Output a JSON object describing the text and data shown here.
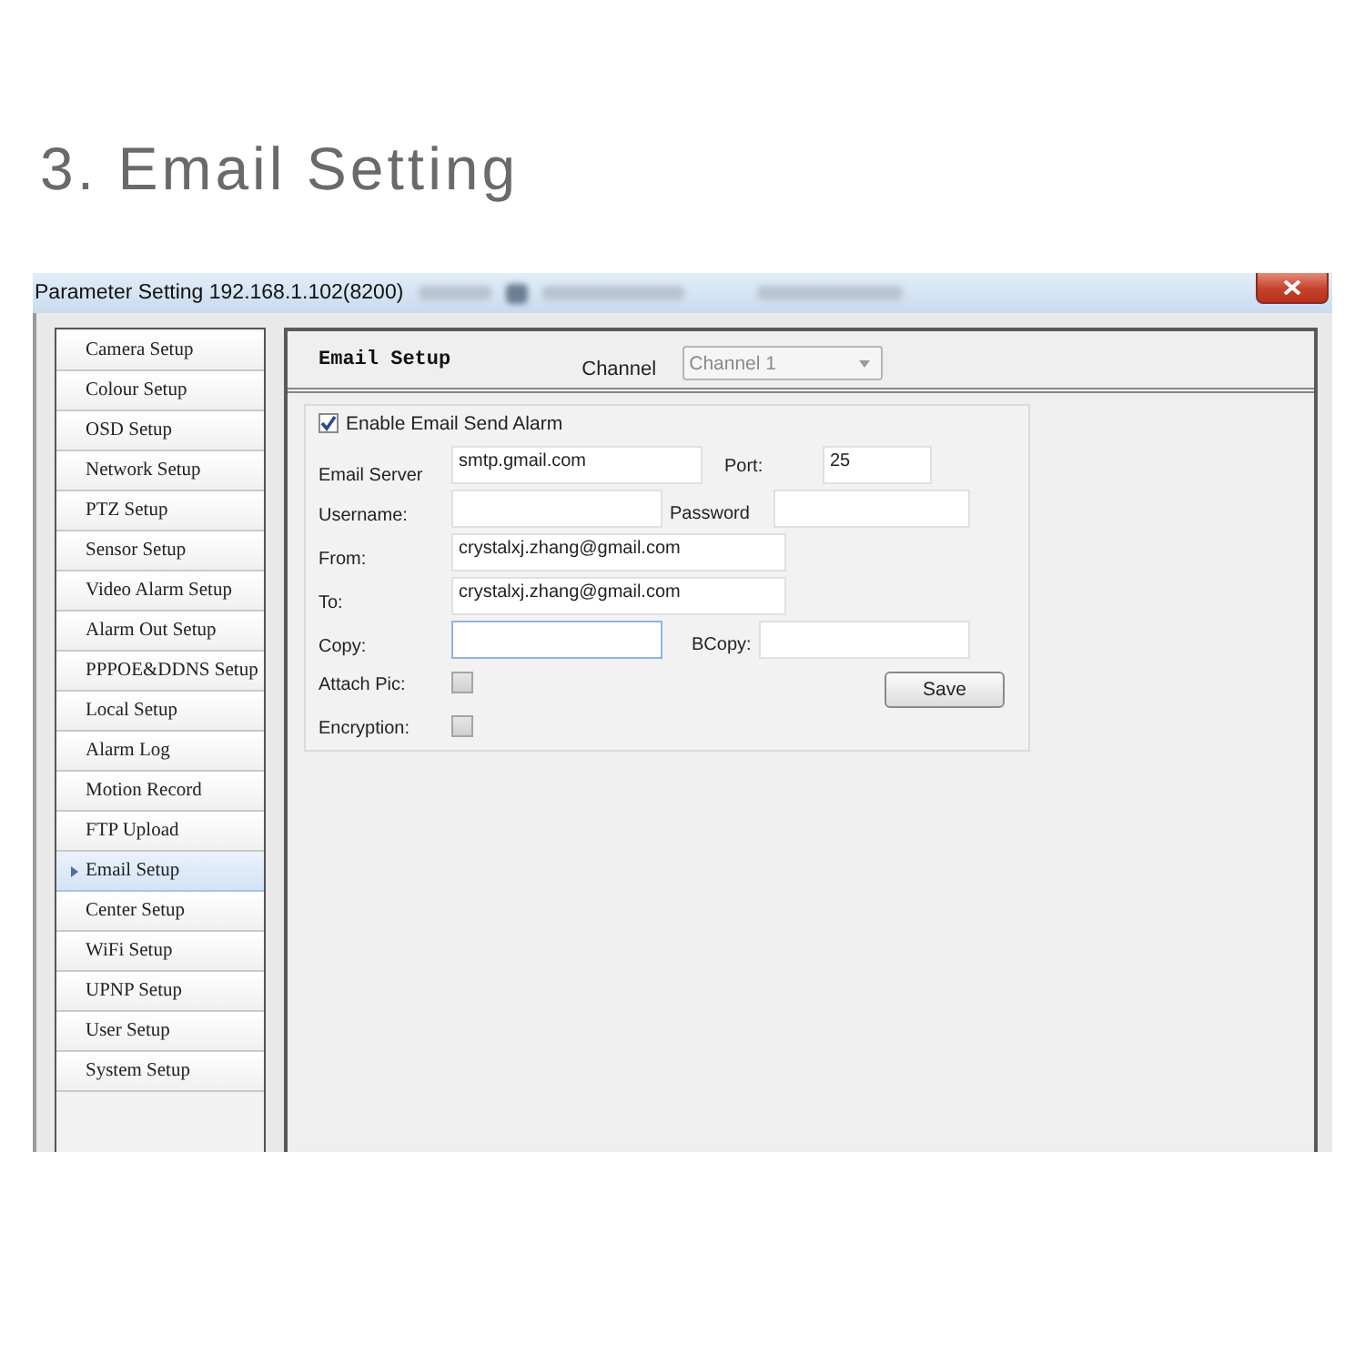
{
  "heading": "3. Email Setting",
  "window": {
    "title": "Parameter Setting 192.168.1.102(8200)"
  },
  "sidebar": {
    "items": [
      {
        "label": "Camera Setup",
        "selected": false
      },
      {
        "label": "Colour Setup",
        "selected": false
      },
      {
        "label": "OSD Setup",
        "selected": false
      },
      {
        "label": "Network Setup",
        "selected": false
      },
      {
        "label": "PTZ Setup",
        "selected": false
      },
      {
        "label": "Sensor Setup",
        "selected": false
      },
      {
        "label": "Video Alarm Setup",
        "selected": false
      },
      {
        "label": "Alarm Out Setup",
        "selected": false
      },
      {
        "label": "PPPOE&DDNS Setup",
        "selected": false
      },
      {
        "label": "Local Setup",
        "selected": false
      },
      {
        "label": "Alarm Log",
        "selected": false
      },
      {
        "label": "Motion Record",
        "selected": false
      },
      {
        "label": "FTP Upload",
        "selected": false
      },
      {
        "label": "Email Setup",
        "selected": true
      },
      {
        "label": "Center Setup",
        "selected": false
      },
      {
        "label": "WiFi Setup",
        "selected": false
      },
      {
        "label": "UPNP Setup",
        "selected": false
      },
      {
        "label": "User Setup",
        "selected": false
      },
      {
        "label": "System Setup",
        "selected": false
      }
    ]
  },
  "panel": {
    "title": "Email Setup",
    "channel": {
      "label": "Channel",
      "value": "Channel 1",
      "disabled": true
    }
  },
  "form": {
    "enable": {
      "label": "Enable Email Send Alarm",
      "checked": true
    },
    "rows": [
      {
        "items": [
          {
            "kind": "input",
            "label": "Email Server",
            "value": "smtp.gmail.com",
            "focused": false
          },
          {
            "kind": "input",
            "label": "Port:",
            "value": "25",
            "focused": false
          }
        ]
      },
      {
        "items": [
          {
            "kind": "input",
            "label": "Username:",
            "focused": false
          },
          {
            "kind": "input",
            "label": "Password",
            "focused": false
          }
        ]
      },
      {
        "items": [
          {
            "kind": "input",
            "label": "From:",
            "value": "crystalxj.zhang@gmail.com",
            "focused": false
          }
        ]
      },
      {
        "items": [
          {
            "kind": "input",
            "label": "To:",
            "value": "crystalxj.zhang@gmail.com",
            "focused": false
          }
        ]
      },
      {
        "items": [
          {
            "kind": "input",
            "label": "Copy:",
            "focused": true
          },
          {
            "kind": "input",
            "label": "BCopy:",
            "focused": false
          }
        ]
      },
      {
        "items": [
          {
            "kind": "checkbox",
            "label": "Attach Pic:",
            "checked": false
          },
          {
            "kind": "button",
            "label": "Save"
          }
        ]
      },
      {
        "items": [
          {
            "kind": "checkbox",
            "label": "Encryption:",
            "checked": false
          }
        ]
      }
    ]
  }
}
